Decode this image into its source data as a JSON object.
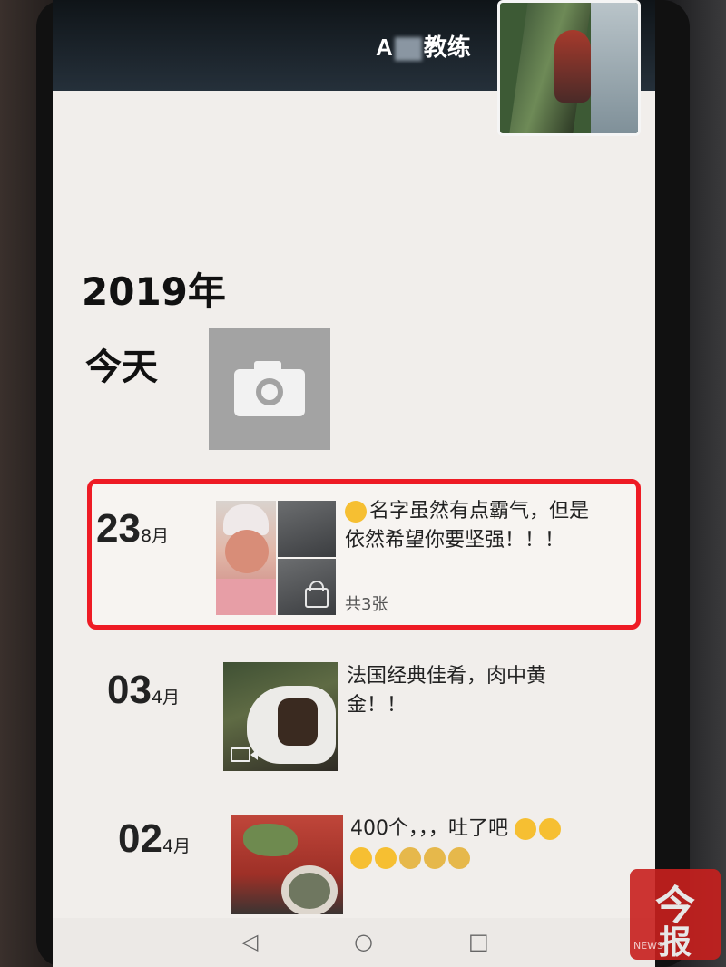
{
  "header": {
    "username_prefix": "A",
    "username_suffix": "教练"
  },
  "timeline": {
    "year": "2019年",
    "today_label": "今天"
  },
  "posts": [
    {
      "day": "23",
      "month": "8月",
      "text_line1": "名字虽然有点霸气，但是",
      "text_line2": "依然希望你要坚强！！！",
      "photo_count": "共3张",
      "highlighted": true
    },
    {
      "day": "03",
      "month": "4月",
      "text_line1": "法国经典佳肴，肉中黄",
      "text_line2": "金！！",
      "media": "video"
    },
    {
      "day": "02",
      "month": "4月",
      "text_line1": "400个，，，吐了吧",
      "emoji_line1": [
        "heart-eyes-emoji",
        "heart-eyes-emoji"
      ],
      "emoji_line2": [
        "heart-eyes-emoji",
        "heart-eyes-emoji",
        "sleepy-emoji",
        "sleepy-emoji",
        "sleepy-emoji"
      ]
    }
  ],
  "navbar": {
    "back": "◁",
    "home": "○",
    "recent": "□"
  },
  "watermark": {
    "top": "今",
    "bottom": "报",
    "small": "NEWS"
  },
  "colors": {
    "highlight_border": "#ee1b24",
    "screen_bg": "#f1eeeb",
    "watermark_bg": "#c8201e"
  }
}
